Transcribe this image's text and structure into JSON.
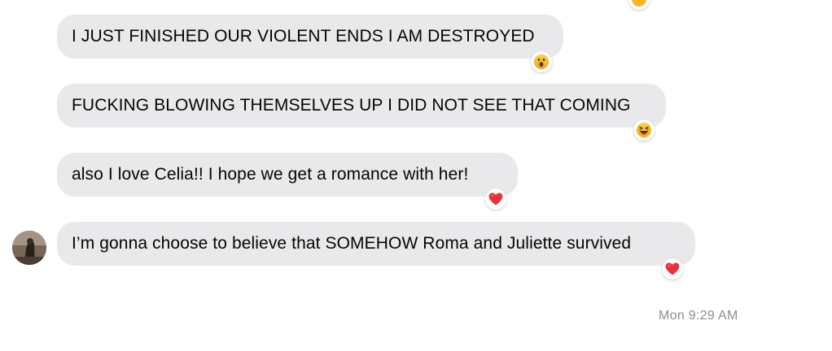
{
  "messages": [
    {
      "text": "I JUST FINISHED OUR VIOLENT ENDS I AM DESTROYED",
      "reaction": "wow-face-icon"
    },
    {
      "text": "FUCKING BLOWING THEMSELVES UP I DID NOT SEE THAT COMING",
      "reaction": "laughing-face-icon"
    },
    {
      "text": "also I love Celia!! I hope we get a romance with her!",
      "reaction": "heart-icon"
    },
    {
      "text": "I’m gonna choose to believe that SOMEHOW Roma and Juliette survived",
      "reaction": "heart-icon"
    }
  ],
  "timestamp": "Mon 9:29 AM",
  "colors": {
    "bubble": "#e9e9ec",
    "text": "#050505",
    "timestamp": "#8a8d91",
    "heart": "#e8323e",
    "emoji_face": "#f7b52c"
  }
}
